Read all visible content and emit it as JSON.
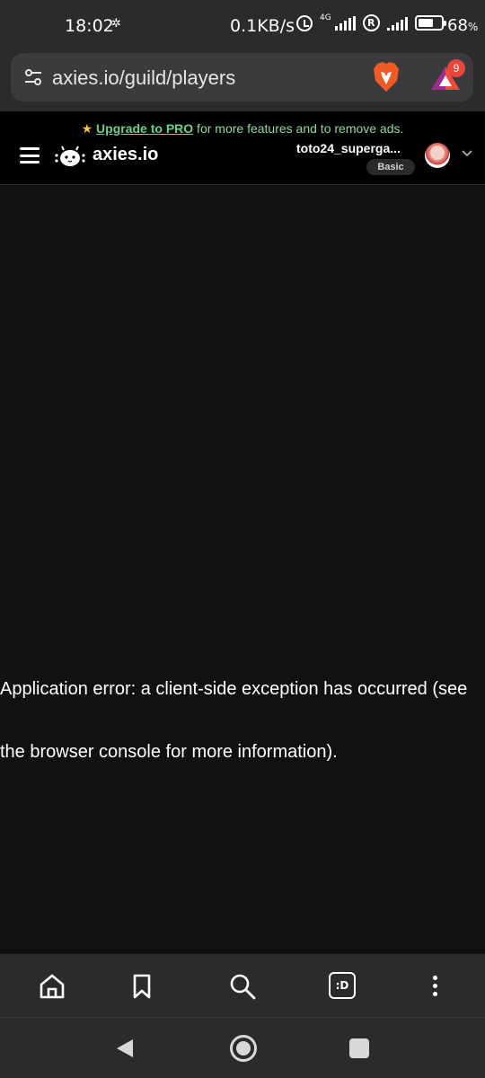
{
  "status_bar": {
    "time": "18:02",
    "network_speed": "0.1KB/s",
    "network_type": "4G",
    "battery_percent": "68",
    "battery_suffix": "%",
    "battery_level": 0.68
  },
  "browser": {
    "url": "axies.io/guild/players",
    "rewards_count": "9"
  },
  "site": {
    "promo_link": "Upgrade to PRO",
    "promo_text": " for more features and to remove ads.",
    "logo_text": "axies.io",
    "username": "toto24_superga...",
    "tier": "Basic"
  },
  "content": {
    "error_message": "Application error: a client-side exception has occurred (see the browser console for more information)."
  },
  "toolbar": {
    "tabs_label": ":D",
    "icons": [
      "home-icon",
      "bookmark-icon",
      "search-icon",
      "tabs-icon",
      "more-icon"
    ]
  },
  "colors": {
    "background": "#111113",
    "chrome": "#2b2b2d",
    "promo_green": "#6fd08a",
    "brave_orange": "#f15a24",
    "badge_red": "#e8463a"
  }
}
